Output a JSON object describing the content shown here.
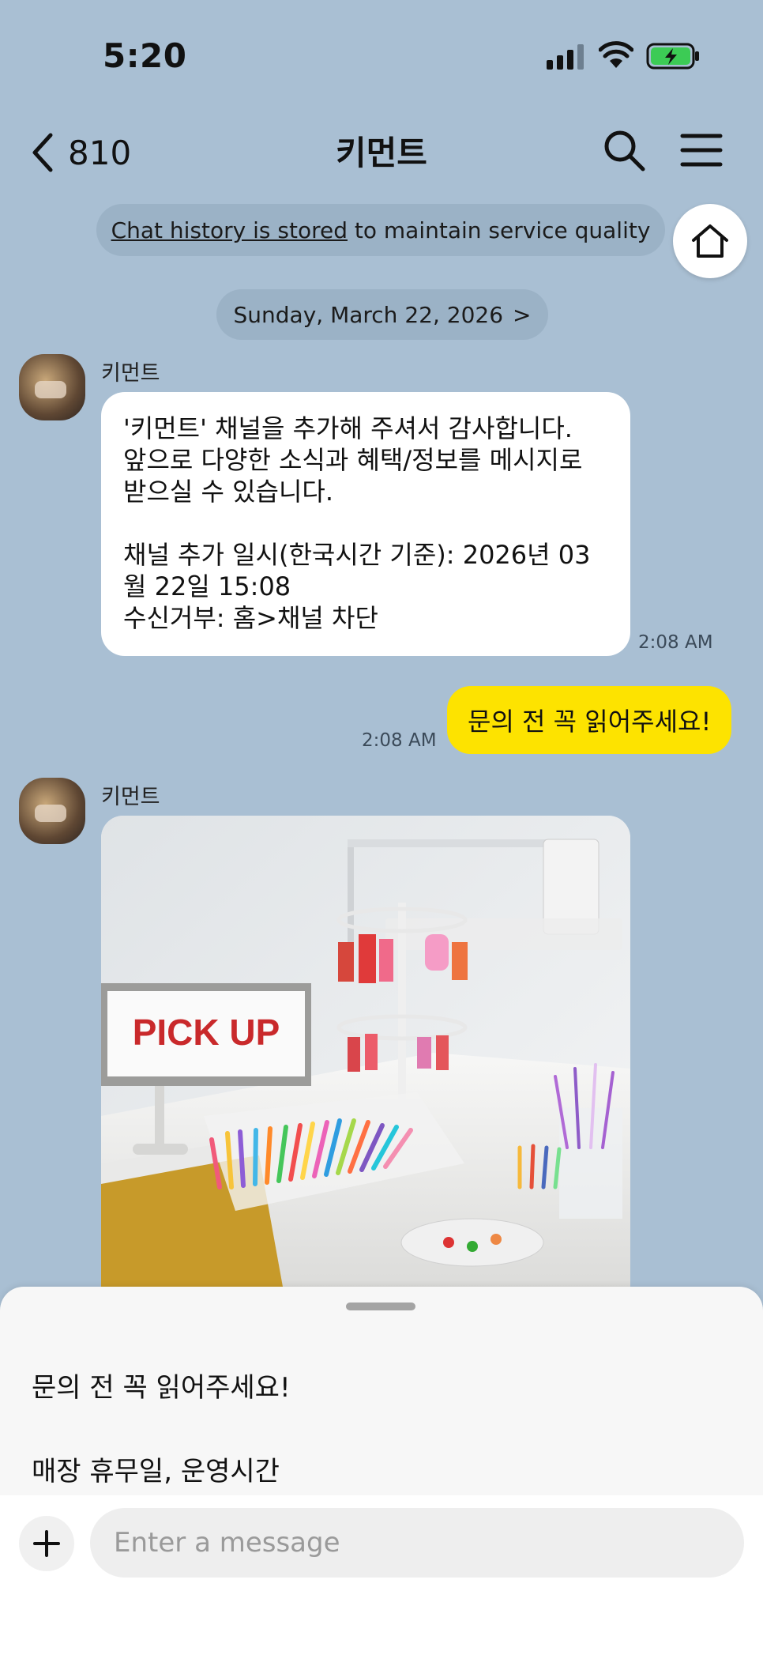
{
  "status_bar": {
    "time": "5:20"
  },
  "header": {
    "back_count": "810",
    "title": "키먼트"
  },
  "notice": {
    "link_text": "Chat history is stored",
    "rest_text": " to maintain service quality"
  },
  "date_divider": {
    "label": "Sunday, March 22, 2026",
    "chevron": ">"
  },
  "messages": [
    {
      "sender": "키먼트",
      "text": "'키먼트' 채널을 추가해 주셔서 감사합니다.\n앞으로 다양한 소식과 혜택/정보를 메시지로\n받으실 수 있습니다.\n\n채널 추가 일시(한국시간 기준): 2026년 03\n월 22일 15:08\n수신거부: 홈>채널 차단",
      "time": "2:08 AM"
    },
    {
      "text": "문의 전 꼭 읽어주세요!",
      "time": "2:08 AM"
    },
    {
      "sender": "키먼트",
      "image_sign_text": "PICK UP"
    }
  ],
  "quick_replies": [
    "문의 전 꼭 읽어주세요!",
    "매장 휴무일, 운영시간"
  ],
  "input": {
    "placeholder": "Enter a message"
  },
  "colors": {
    "background": "#a9bfd3",
    "outgoing_bubble": "#fde300",
    "battery": "#3ccb55"
  }
}
